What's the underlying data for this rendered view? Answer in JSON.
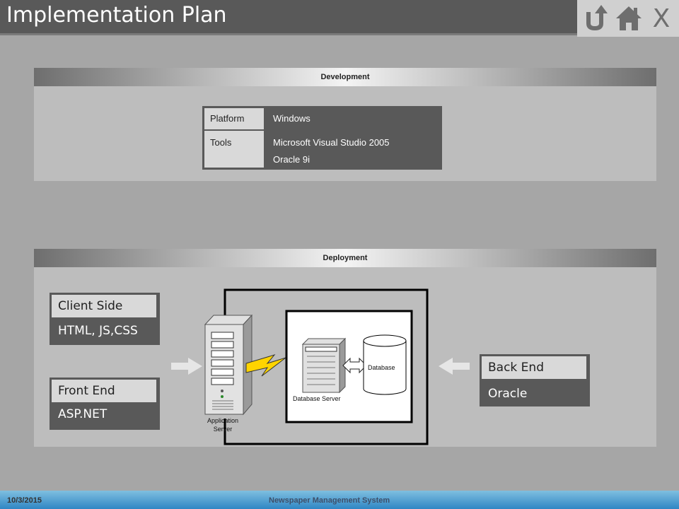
{
  "header": {
    "title": "Implementation Plan"
  },
  "nav": {
    "exit_label": "X"
  },
  "development": {
    "heading": "Development",
    "rows": [
      {
        "label": "Platform",
        "values": [
          "Windows"
        ]
      },
      {
        "label": "Tools",
        "values": [
          "Microsoft Visual Studio 2005",
          "Oracle 9i"
        ]
      }
    ]
  },
  "deployment": {
    "heading": "Deployment",
    "client_side": {
      "title": "Client Side",
      "value": "HTML, JS,CSS"
    },
    "front_end": {
      "title": "Front End",
      "value": "ASP.NET"
    },
    "back_end": {
      "title": "Back End",
      "value": "Oracle"
    },
    "diagram": {
      "app_server_label": [
        "Application",
        "Server"
      ],
      "db_server_label": "Database Server",
      "database_label": "Database"
    }
  },
  "footer": {
    "date": "10/3/2015",
    "system_name": "Newspaper  Management  System"
  }
}
